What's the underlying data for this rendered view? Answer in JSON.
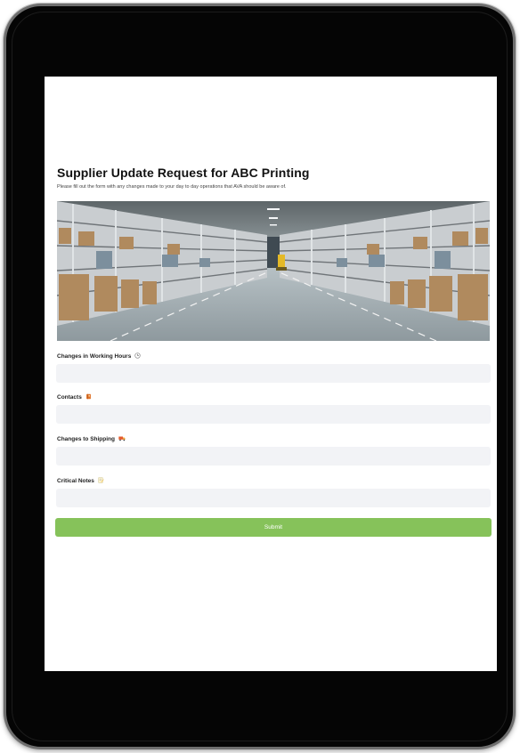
{
  "form": {
    "title": "Supplier Update Request for ABC Printing",
    "subtitle": "Please fill out the form with any changes made to your day to day operations that AVA should be aware of.",
    "fields": [
      {
        "label": "Changes in Working Hours",
        "icon": "clock-icon",
        "value": "",
        "placeholder": ""
      },
      {
        "label": "Contacts",
        "icon": "contact-book-icon",
        "value": "",
        "placeholder": ""
      },
      {
        "label": "Changes to Shipping",
        "icon": "delivery-truck-icon",
        "value": "",
        "placeholder": ""
      },
      {
        "label": "Critical Notes",
        "icon": "memo-pencil-icon",
        "value": "",
        "placeholder": ""
      }
    ],
    "submit_label": "Submit"
  },
  "hero_image": {
    "subject": "warehouse-aisle-photo"
  },
  "colors": {
    "submit_bg": "#86c25a",
    "input_bg": "#f2f3f6",
    "device_frame": "#050505"
  }
}
